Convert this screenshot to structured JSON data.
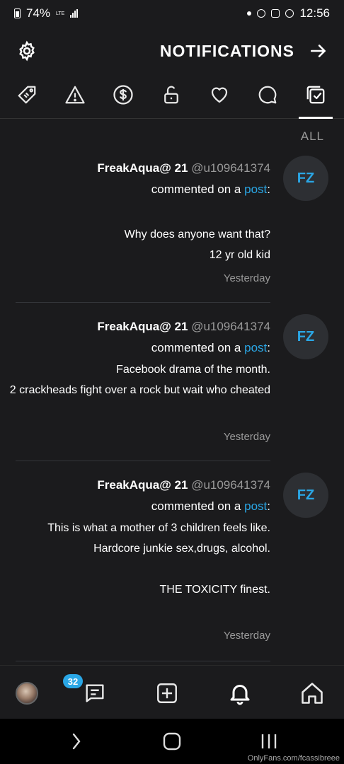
{
  "status_bar": {
    "time": "12:56",
    "battery": "74%",
    "network": "LTE",
    "icons": [
      "dot-icon",
      "messenger-icon",
      "instagram-icon",
      "vpn-icon"
    ]
  },
  "header": {
    "title": "NOTIFICATIONS",
    "settings_icon": "gear-icon",
    "back_icon": "arrow-icon"
  },
  "tabs": [
    {
      "name": "all",
      "icon": "all-icon",
      "active": true
    },
    {
      "name": "comments",
      "icon": "comment-icon"
    },
    {
      "name": "likes",
      "icon": "heart-icon"
    },
    {
      "name": "subscriptions",
      "icon": "lock-icon"
    },
    {
      "name": "tips",
      "icon": "dollar-icon"
    },
    {
      "name": "warnings",
      "icon": "warning-icon"
    },
    {
      "name": "promotions",
      "icon": "tag-icon"
    }
  ],
  "filter_label": "ALL",
  "notifications": [
    {
      "avatar": "FZ",
      "name": "FreakAqua@ 21",
      "handle": "@u109641374",
      "action_prefix": "commented on a",
      "action_link": "post",
      "action_suffix": ":",
      "message": "\nWhy does anyone want that?\n12 yr old kid",
      "time": "Yesterday"
    },
    {
      "avatar": "FZ",
      "name": "FreakAqua@ 21",
      "handle": "@u109641374",
      "action_prefix": "commented on a",
      "action_link": "post",
      "action_suffix": ":",
      "message": "Facebook drama of the month.\n2 crackheads fight over a rock but wait who cheated",
      "time": "Yesterday"
    },
    {
      "avatar": "FZ",
      "name": "FreakAqua@ 21",
      "handle": "@u109641374",
      "action_prefix": "commented on a",
      "action_link": "post",
      "action_suffix": ":",
      "message": "This is what a mother of 3 children feels like. Hardcore junkie sex,drugs, alcohol.\n\nTHE TOXICITY finest.",
      "time": "Yesterday"
    }
  ],
  "bottom_nav": {
    "items": [
      "home-icon",
      "bell-icon",
      "add-icon",
      "chat-icon",
      "profile-avatar"
    ],
    "chat_badge": "32"
  },
  "watermark": "OnlyFans.com/fcassibreee"
}
